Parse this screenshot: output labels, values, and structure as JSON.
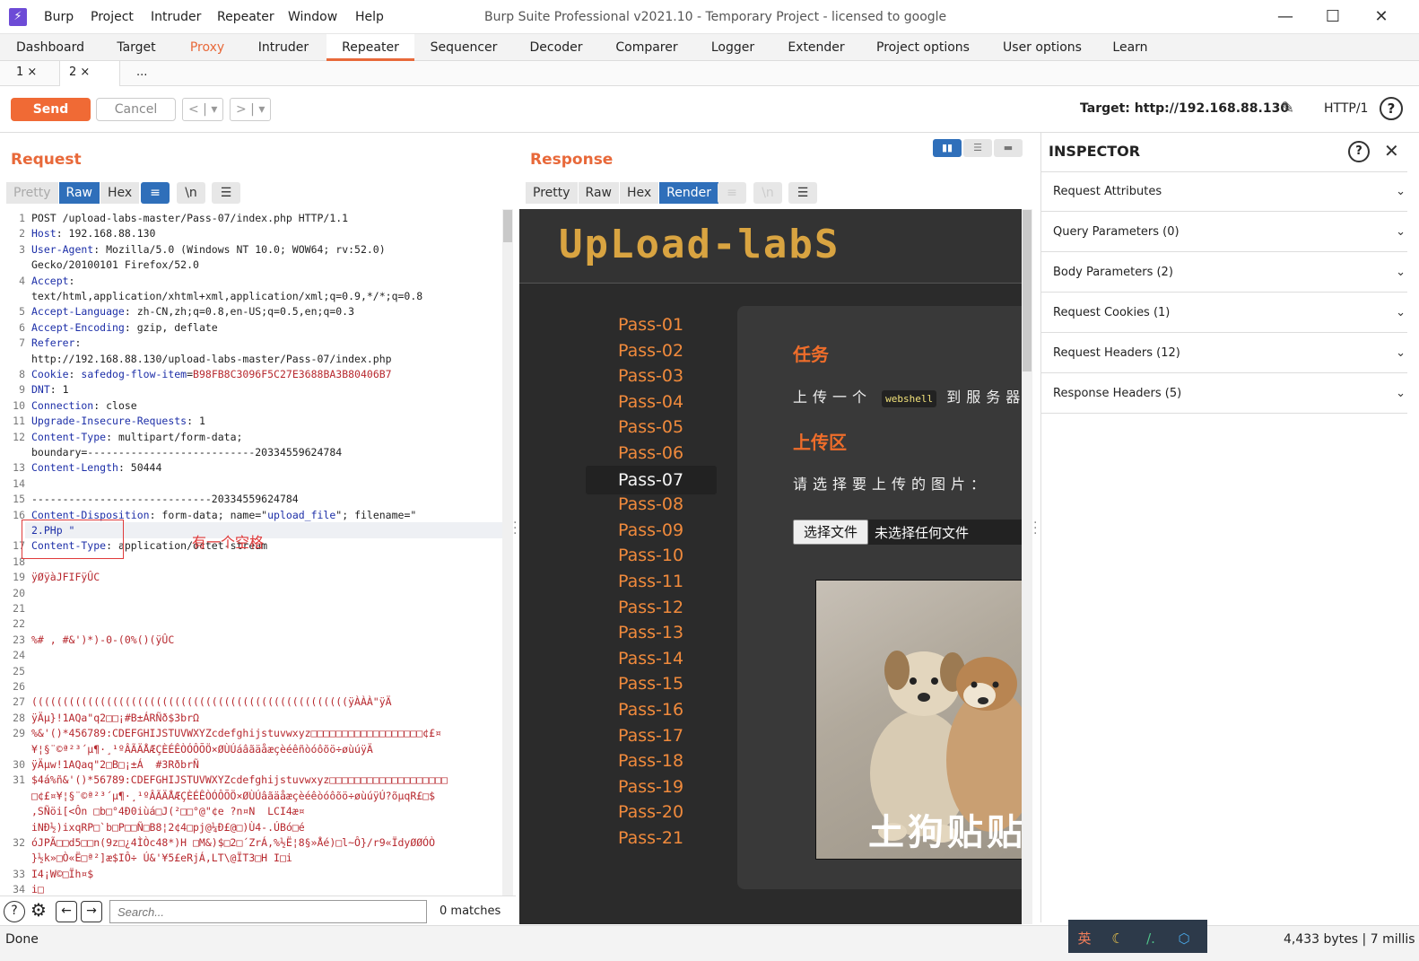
{
  "window": {
    "title": "Burp Suite Professional v2021.10 - Temporary Project - licensed to google",
    "menu": [
      "Burp",
      "Project",
      "Intruder",
      "Repeater",
      "Window",
      "Help"
    ]
  },
  "main_tabs": [
    "Dashboard",
    "Target",
    "Proxy",
    "Intruder",
    "Repeater",
    "Sequencer",
    "Decoder",
    "Comparer",
    "Logger",
    "Extender",
    "Project options",
    "User options",
    "Learn"
  ],
  "active_main_tab": "Repeater",
  "repeater_tabs": [
    {
      "label": "1 ×"
    },
    {
      "label": "2 ×"
    },
    {
      "label": "..."
    }
  ],
  "toolbar": {
    "send_label": "Send",
    "cancel_label": "Cancel",
    "target_label": "Target: http://192.168.88.130",
    "http_version": "HTTP/1"
  },
  "request": {
    "title": "Request",
    "views": [
      "Pretty",
      "Raw",
      "Hex"
    ],
    "active_view": "Raw",
    "wrap_icon": "≡",
    "newline_icon": "\\n",
    "menu_icon": "☰",
    "annotation": "有一个空格",
    "lines": [
      {
        "n": "1",
        "parts": [
          {
            "c": "",
            "t": "POST /upload-labs-master/Pass-07/index.php HTTP/1.1"
          }
        ]
      },
      {
        "n": "2",
        "parts": [
          {
            "c": "hk",
            "t": "Host"
          },
          {
            "c": "",
            "t": ": 192.168.88.130"
          }
        ]
      },
      {
        "n": "3",
        "parts": [
          {
            "c": "hk",
            "t": "User-Agent"
          },
          {
            "c": "",
            "t": ": Mozilla/5.0 (Windows NT 10.0; WOW64; rv:52.0)"
          }
        ]
      },
      {
        "n": "",
        "parts": [
          {
            "c": "",
            "t": "Gecko/20100101 Firefox/52.0"
          }
        ]
      },
      {
        "n": "4",
        "parts": [
          {
            "c": "hk",
            "t": "Accept"
          },
          {
            "c": "",
            "t": ":"
          }
        ]
      },
      {
        "n": "",
        "parts": [
          {
            "c": "",
            "t": "text/html,application/xhtml+xml,application/xml;q=0.9,*/*;q=0.8"
          }
        ]
      },
      {
        "n": "5",
        "parts": [
          {
            "c": "hk",
            "t": "Accept-Language"
          },
          {
            "c": "",
            "t": ": zh-CN,zh;q=0.8,en-US;q=0.5,en;q=0.3"
          }
        ]
      },
      {
        "n": "6",
        "parts": [
          {
            "c": "hk",
            "t": "Accept-Encoding"
          },
          {
            "c": "",
            "t": ": gzip, deflate"
          }
        ]
      },
      {
        "n": "7",
        "parts": [
          {
            "c": "hk",
            "t": "Referer"
          },
          {
            "c": "",
            "t": ":"
          }
        ]
      },
      {
        "n": "",
        "parts": [
          {
            "c": "",
            "t": "http://192.168.88.130/upload-labs-master/Pass-07/index.php"
          }
        ]
      },
      {
        "n": "8",
        "parts": [
          {
            "c": "hk",
            "t": "Cookie"
          },
          {
            "c": "",
            "t": ": "
          },
          {
            "c": "hk",
            "t": "safedog-flow-item"
          },
          {
            "c": "",
            "t": "="
          },
          {
            "c": "hv",
            "t": "B98FB8C3096F5C27E3688BA3B80406B7"
          }
        ]
      },
      {
        "n": "9",
        "parts": [
          {
            "c": "hk",
            "t": "DNT"
          },
          {
            "c": "",
            "t": ": 1"
          }
        ]
      },
      {
        "n": "10",
        "parts": [
          {
            "c": "hk",
            "t": "Connection"
          },
          {
            "c": "",
            "t": ": close"
          }
        ]
      },
      {
        "n": "11",
        "parts": [
          {
            "c": "hk",
            "t": "Upgrade-Insecure-Requests"
          },
          {
            "c": "",
            "t": ": 1"
          }
        ]
      },
      {
        "n": "12",
        "parts": [
          {
            "c": "hk",
            "t": "Content-Type"
          },
          {
            "c": "",
            "t": ": multipart/form-data;"
          }
        ]
      },
      {
        "n": "",
        "parts": [
          {
            "c": "",
            "t": "boundary=---------------------------20334559624784"
          }
        ]
      },
      {
        "n": "13",
        "parts": [
          {
            "c": "hk",
            "t": "Content-Length"
          },
          {
            "c": "",
            "t": ": 50444"
          }
        ]
      },
      {
        "n": "14",
        "parts": [
          {
            "c": "",
            "t": ""
          }
        ]
      },
      {
        "n": "15",
        "parts": [
          {
            "c": "",
            "t": "-----------------------------20334559624784"
          }
        ]
      },
      {
        "n": "16",
        "parts": [
          {
            "c": "hk",
            "t": "Content-Disposition"
          },
          {
            "c": "",
            "t": ": form-data; name=\""
          },
          {
            "c": "hk",
            "t": "upload_file"
          },
          {
            "c": "",
            "t": "\"; filename=\""
          }
        ]
      },
      {
        "n": "",
        "parts": [
          {
            "c": "hk",
            "t": "2.PHp \""
          }
        ]
      },
      {
        "n": "17",
        "parts": [
          {
            "c": "hk",
            "t": "Content-Type"
          },
          {
            "c": "",
            "t": ": application/octet-stream"
          }
        ]
      },
      {
        "n": "18",
        "parts": [
          {
            "c": "",
            "t": ""
          }
        ]
      },
      {
        "n": "19",
        "parts": [
          {
            "c": "bin",
            "t": "ÿØÿàJFIFÿÛC"
          }
        ]
      },
      {
        "n": "20",
        "parts": [
          {
            "c": "",
            "t": ""
          }
        ]
      },
      {
        "n": "21",
        "parts": [
          {
            "c": "",
            "t": ""
          }
        ]
      },
      {
        "n": "22",
        "parts": [
          {
            "c": "",
            "t": ""
          }
        ]
      },
      {
        "n": "23",
        "parts": [
          {
            "c": "bin",
            "t": "%# , #&')*)-0-(0%()(ÿÛC"
          }
        ]
      },
      {
        "n": "24",
        "parts": [
          {
            "c": "",
            "t": ""
          }
        ]
      },
      {
        "n": "25",
        "parts": [
          {
            "c": "",
            "t": ""
          }
        ]
      },
      {
        "n": "26",
        "parts": [
          {
            "c": "",
            "t": ""
          }
        ]
      },
      {
        "n": "27",
        "parts": [
          {
            "c": "bin",
            "t": "(((((((((((((((((((((((((((((((((((((((((((((((((((ÿÀÀÀ\"ÿÄ"
          }
        ]
      },
      {
        "n": "28",
        "parts": [
          {
            "c": "bin",
            "t": "ÿÄµ}!1AQa\"q2□□¡#B±ÁRÑð$3brΩ"
          }
        ]
      },
      {
        "n": "29",
        "parts": [
          {
            "c": "bin",
            "t": "%&'()*456789:CDEFGHIJSTUVWXYZcdefghijstuvwxyz□□□□□□□□□□□□□□□□□□¢£¤"
          }
        ]
      },
      {
        "n": "",
        "parts": [
          {
            "c": "bin",
            "t": "¥¦§¨©ª²³´µ¶·¸¹ºÂÃÄÅÆÇÈÉÊÒÓÔÕÖ×ØÙÚáâãäåæçèéêñòóôõö÷øùúÿÄ"
          }
        ]
      },
      {
        "n": "30",
        "parts": [
          {
            "c": "bin",
            "t": "ÿÄµw!1AQaq\"2□B□¡±Á  #3RðbrÑ"
          }
        ]
      },
      {
        "n": "31",
        "parts": [
          {
            "c": "bin",
            "t": "$4á%ñ&'()*56789:CDEFGHIJSTUVWXYZcdefghijstuvwxyz□□□□□□□□□□□□□□□□□□□"
          }
        ]
      },
      {
        "n": "",
        "parts": [
          {
            "c": "bin",
            "t": "□¢£¤¥¦§¨©ª²³´µ¶·¸¹ºÂÃÄÅÆÇÈÉÊÒÓÔÕÖ×ØÙÚâãäåæçèéêòóôõö÷øùúÿÚ?õµqR£□$"
          }
        ]
      },
      {
        "n": "",
        "parts": [
          {
            "c": "bin",
            "t": ",SÑöi[<Ôn □b□°4Ð0iùá□J(²□□°@\"¢e ?n¤N  LCI4æ¤"
          }
        ]
      },
      {
        "n": "",
        "parts": [
          {
            "c": "bin",
            "t": "iNÐ½)ixqRP□`b□P□□Ñ□B8¦2¢4□pj@¼Ð£@□)Ù4-.ÚBó□é"
          }
        ]
      },
      {
        "n": "32",
        "parts": [
          {
            "c": "bin",
            "t": "óJPÃ□□d5□□n(9z□¿4ÌÒc48*)H □M&)$□2□´ZrÁ,%½Ë¦8§»Åé)□l~Ô}/r9«ÏdyØØÓÒ"
          }
        ]
      },
      {
        "n": "",
        "parts": [
          {
            "c": "bin",
            "t": "}½k»□Ò«Ë□ª²]æ$IÔ÷ Ú&'¥5£eRjÁ,LT\\@ÏT3□H I□i"
          }
        ]
      },
      {
        "n": "33",
        "parts": [
          {
            "c": "bin",
            "t": "I4¡W©□Ïh¤$"
          }
        ]
      },
      {
        "n": "34",
        "parts": [
          {
            "c": "bin",
            "t": "i□"
          }
        ]
      }
    ],
    "search_placeholder": "Search...",
    "matches": "0 matches"
  },
  "response": {
    "title": "Response",
    "views": [
      "Pretty",
      "Raw",
      "Hex",
      "Render"
    ],
    "active_view": "Render",
    "page": {
      "logo": "UpLoad-labS",
      "passes": [
        "Pass-01",
        "Pass-02",
        "Pass-03",
        "Pass-04",
        "Pass-05",
        "Pass-06",
        "Pass-07",
        "Pass-08",
        "Pass-09",
        "Pass-10",
        "Pass-11",
        "Pass-12",
        "Pass-13",
        "Pass-14",
        "Pass-15",
        "Pass-16",
        "Pass-17",
        "Pass-18",
        "Pass-19",
        "Pass-20",
        "Pass-21"
      ],
      "current_pass": "Pass-07",
      "task_heading": "任务",
      "task_prefix": "上传一个",
      "task_code": "webshell",
      "task_suffix": "到服务器",
      "upload_heading": "上传区",
      "upload_prompt": "请选择要上传的图片：",
      "file_button": "选择文件",
      "file_status": "未选择任何文件",
      "image_watermark": "土狗贴贴"
    }
  },
  "inspector": {
    "title": "INSPECTOR",
    "sections": [
      "Request Attributes",
      "Query Parameters (0)",
      "Body Parameters (2)",
      "Request Cookies (1)",
      "Request Headers (12)",
      "Response Headers (5)"
    ]
  },
  "status": {
    "text": "Done",
    "bytes": "4,433 bytes | 7 millis",
    "tray": [
      "英",
      "☾",
      "/.",
      "⬡"
    ]
  },
  "colors": {
    "accent": "#e8693a",
    "active_view": "#2f6fba",
    "request_key": "#1d2fa8",
    "request_value": "#b7282e"
  }
}
